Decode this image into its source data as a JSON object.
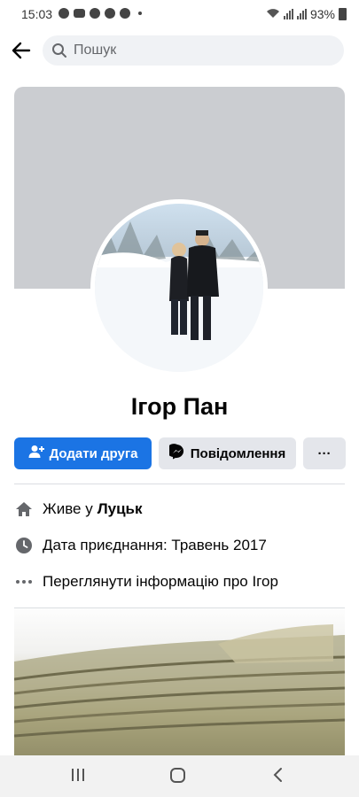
{
  "status_bar": {
    "time": "15:03",
    "battery": "93%"
  },
  "search": {
    "placeholder": "Пошук"
  },
  "profile": {
    "name": "Ігор Пан"
  },
  "actions": {
    "add_friend": "Додати друга",
    "message": "Повідомлення",
    "more": "···"
  },
  "details": {
    "lives_prefix": "Живе у",
    "city": "Луцьк",
    "joined": "Дата приєднання: Травень 2017",
    "see_info": "Переглянути інформацію про Ігор"
  },
  "icons": {
    "back": "arrow-left-icon",
    "search": "search-icon",
    "home": "home-icon",
    "clock": "clock-icon",
    "more": "more-dots-icon",
    "messenger": "messenger-icon",
    "add_user": "add-user-icon"
  },
  "colors": {
    "primary": "#1b74e4",
    "button_gray": "#e4e6eb",
    "cover": "#cbcdd1"
  }
}
